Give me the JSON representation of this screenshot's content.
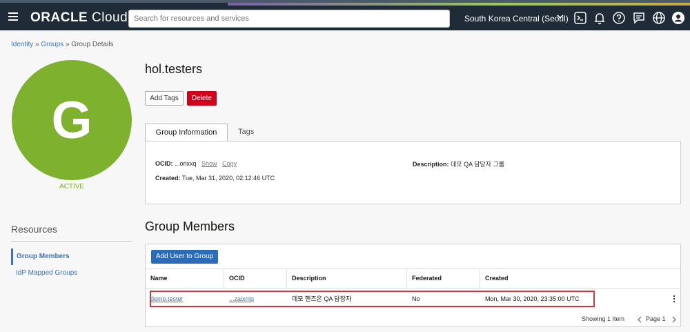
{
  "header": {
    "logo_brand": "ORACLE",
    "logo_product": "Cloud",
    "search_placeholder": "Search for resources and services",
    "region": "South Korea Central (Seoul)",
    "icons": [
      "menu-icon",
      "cloud-shell-icon",
      "bell-icon",
      "help-icon",
      "chat-icon",
      "globe-icon",
      "user-icon"
    ]
  },
  "breadcrumb": {
    "identity": "Identity",
    "groups": "Groups",
    "current": "Group Details",
    "sep": "»"
  },
  "group": {
    "avatar_letter": "G",
    "status": "ACTIVE",
    "name": "hol.testers",
    "add_tags": "Add Tags",
    "delete": "Delete"
  },
  "tabs": {
    "info": "Group Information",
    "tags": "Tags"
  },
  "info": {
    "ocid_label": "OCID:",
    "ocid_value": "...orixxq",
    "show": "Show",
    "copy": "Copy",
    "description_label": "Description:",
    "description_value": "데모 QA 담당자 그룹",
    "created_label": "Created:",
    "created_value": "Tue, Mar 31, 2020, 02:12:46 UTC"
  },
  "resources": {
    "title": "Resources",
    "items": [
      "Group Members",
      "IdP Mapped Groups"
    ]
  },
  "members": {
    "title": "Group Members",
    "add_button": "Add User to Group",
    "columns": [
      "Name",
      "OCID",
      "Description",
      "Federated",
      "Created"
    ],
    "rows": [
      {
        "name": "demo.tester",
        "ocid": "...zaixmq",
        "description": "데모 핸즈온 QA 담장자",
        "federated": "No",
        "created": "Mon, Mar 30, 2020, 23:35:00 UTC"
      }
    ],
    "showing": "Showing 1 Item",
    "page": "Page 1"
  },
  "colors": {
    "header_bg": "#1f2b36",
    "avatar_green": "#7db12e",
    "link_blue": "#3b73b9",
    "delete_red": "#d0021b",
    "highlight_red": "#d0353a"
  }
}
